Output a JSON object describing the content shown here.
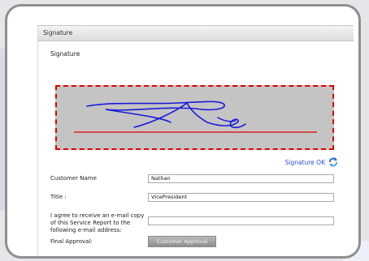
{
  "header": {
    "title": "Signature"
  },
  "signature": {
    "section_label": "Signature",
    "ok_label": "Signature OK",
    "colors": {
      "border": "#e00000",
      "pad": "#c4c4c4",
      "baseline": "#e00000",
      "ink": "#1a1ad9"
    }
  },
  "form": {
    "customer_name_label": "Customer Name",
    "customer_name_value": "Nathan",
    "title_label": "Title :",
    "title_value": "VicePresident",
    "email_label": "I agree to receive an e-mail copy of this Service Report to the following e-mail address:",
    "email_value": "",
    "final_approval_label": "Final Approval:",
    "approval_button_label": "Customer Approval"
  }
}
